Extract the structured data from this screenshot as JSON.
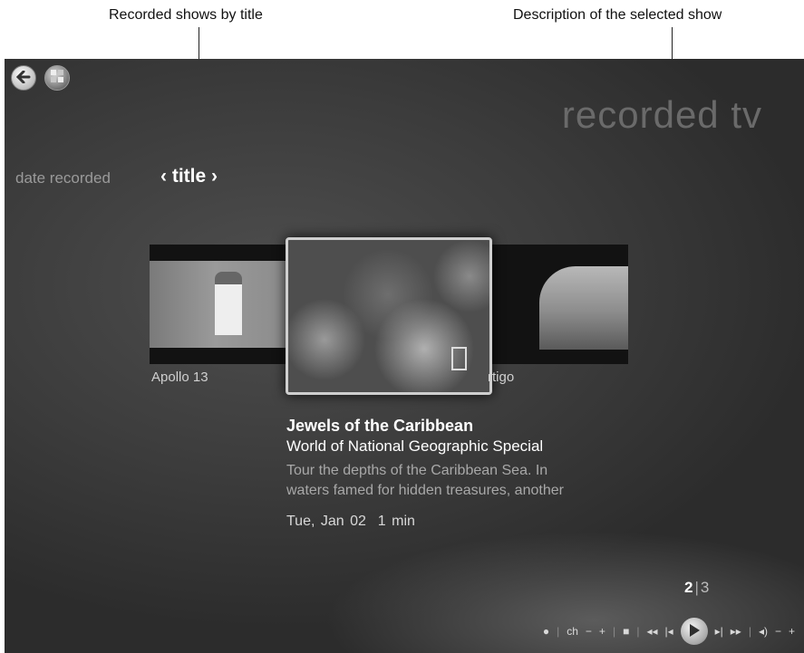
{
  "callouts": {
    "left": "Recorded shows by title",
    "right": "Description of the selected show"
  },
  "header": {
    "page_title": "recorded tv",
    "back_icon": "back-arrow-icon",
    "start_icon": "windows-start-icon"
  },
  "sort": {
    "date_recorded": "date recorded",
    "title": "‹ title ›"
  },
  "gallery": {
    "left_label": "Apollo 13",
    "right_label": "rtigo"
  },
  "selected_show": {
    "title": "Jewels of the Caribbean",
    "subtitle": "World of National Geographic Special",
    "description_line1": "Tour the depths of the Caribbean Sea. In",
    "description_line2": "waters famed for hidden treasures, another",
    "date": "Tue, Jan 02",
    "duration": "1 min"
  },
  "pager": {
    "current": "2",
    "separator": "|",
    "total": "3"
  },
  "transport": {
    "record": "●",
    "channel": "ch",
    "channel_down": "−",
    "channel_up": "+",
    "stop": "■",
    "rewind": "◂◂",
    "skip_back": "|◂",
    "play": "▶",
    "skip_forward": "▸|",
    "fast_forward": "▸▸",
    "volume": "◂)",
    "volume_down": "−",
    "volume_up": "+",
    "separator": "|"
  }
}
